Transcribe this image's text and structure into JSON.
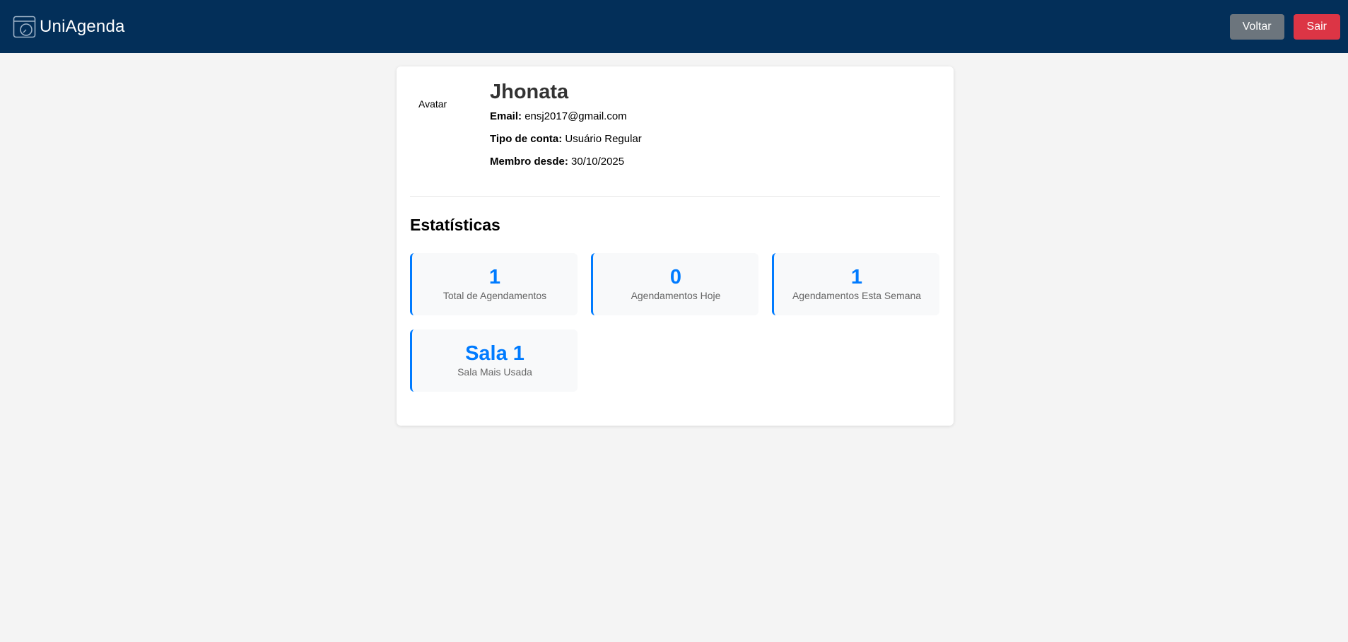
{
  "app": {
    "name": "UniAgenda",
    "logo_icon": "calendar-clock-icon"
  },
  "nav": {
    "back_label": "Voltar",
    "logout_label": "Sair"
  },
  "profile": {
    "avatar_alt": "Avatar",
    "name": "Jhonata",
    "email_label": "Email:",
    "email": "ensj2017@gmail.com",
    "account_type_label": "Tipo de conta:",
    "account_type": "Usuário Regular",
    "member_since_label": "Membro desde:",
    "member_since": "30/10/2025"
  },
  "statistics": {
    "title": "Estatísticas",
    "items": [
      {
        "value": "1",
        "label": "Total de Agendamentos"
      },
      {
        "value": "0",
        "label": "Agendamentos Hoje"
      },
      {
        "value": "1",
        "label": "Agendamentos Esta Semana"
      },
      {
        "value": "Sala 1",
        "label": "Sala Mais Usada"
      }
    ]
  },
  "colors": {
    "header_bg": "#032f59",
    "back_button": "#6c757d",
    "logout_button": "#dc3545",
    "accent": "#007bff",
    "page_bg": "#f4f4f4"
  }
}
